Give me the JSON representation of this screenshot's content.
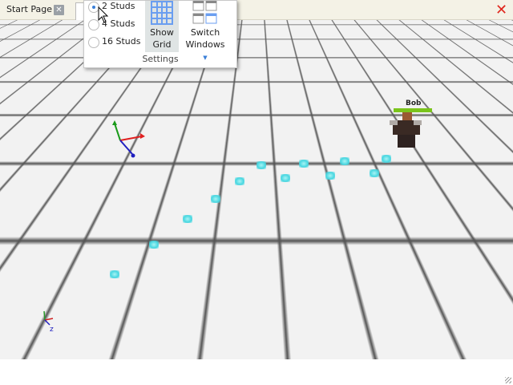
{
  "tabs": [
    {
      "label": "Start Page",
      "close_icon": "close-icon"
    }
  ],
  "window_close_icon": "close-icon",
  "grid_menu": {
    "options": [
      {
        "label": "2 Studs",
        "selected": true
      },
      {
        "label": "4 Studs",
        "selected": false
      },
      {
        "label": "16 Studs",
        "selected": false
      }
    ],
    "show_grid": {
      "label_line1": "Show",
      "label_line2": "Grid",
      "active": true
    },
    "switch_windows": {
      "label_line1": "Switch",
      "label_line2": "Windows"
    },
    "group_label": "Settings"
  },
  "character": {
    "name": "Bob",
    "health": 1.0
  },
  "colors": {
    "accent": "#3a7fd8",
    "close": "#e0281e",
    "marker": "#47d6e0",
    "health": "#7ac41c"
  }
}
